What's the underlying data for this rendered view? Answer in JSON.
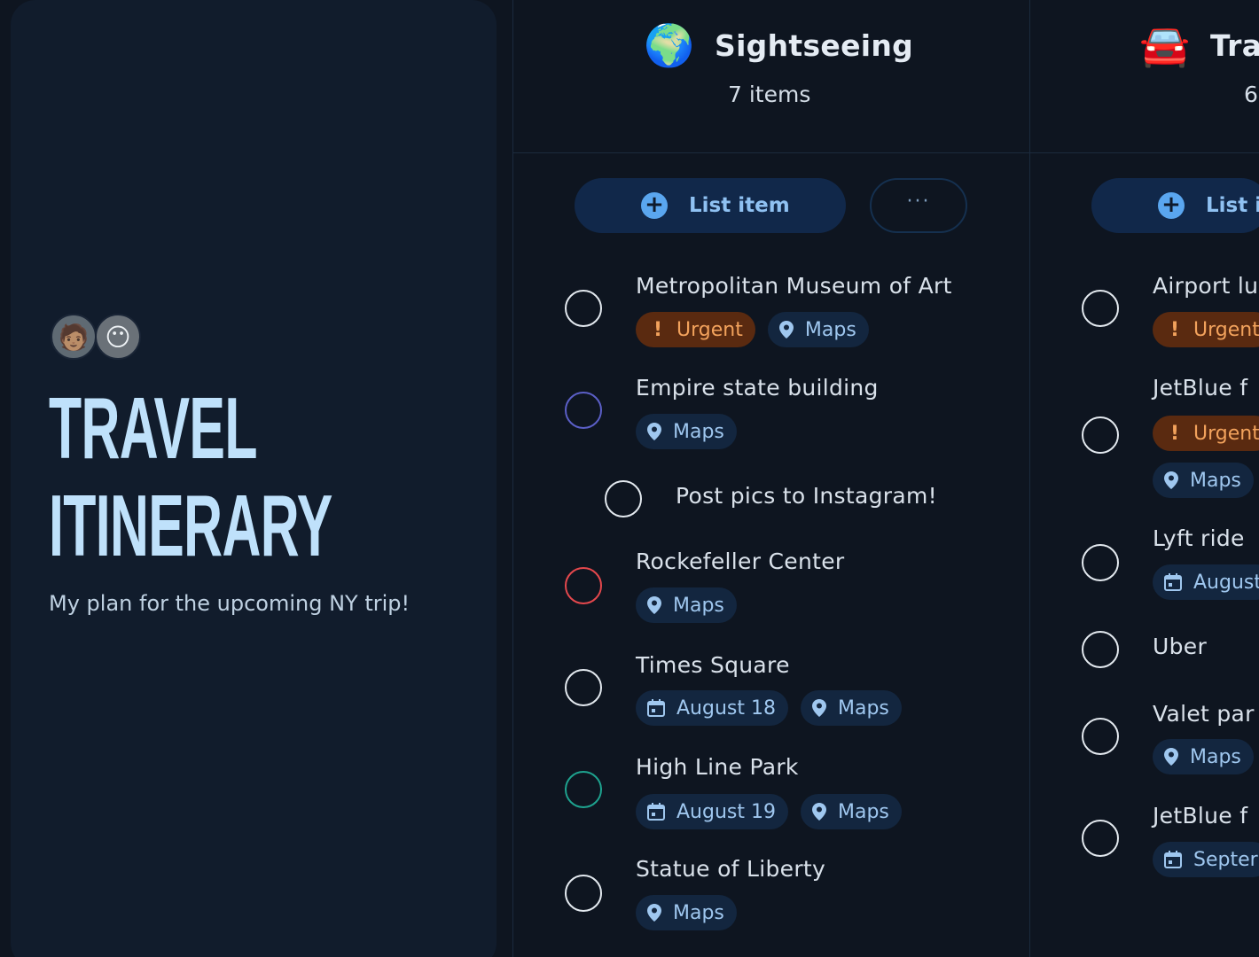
{
  "sidebar": {
    "avatars": [
      "🧑🏽",
      "😶"
    ],
    "title_line1": "TRAVEL",
    "title_line2": "ITINERARY",
    "description": "My plan for the upcoming NY trip!"
  },
  "columns": [
    {
      "emoji": "🌍",
      "name": "Sightseeing",
      "count": "7 items",
      "add_label": "List item",
      "more_label": "···",
      "items": [
        {
          "title": "Metropolitan Museum of Art",
          "check_color": "#e3e9ef",
          "tags": [
            {
              "type": "urgent",
              "label": "Urgent",
              "icon": "!"
            },
            {
              "type": "maps",
              "label": "Maps",
              "icon": "map-pin-icon"
            }
          ]
        },
        {
          "title": "Empire state building",
          "check_color": "#5b5fc7",
          "tags": [
            {
              "type": "maps",
              "label": "Maps",
              "icon": "map-pin-icon"
            }
          ]
        },
        {
          "title": "Post pics to Instagram!",
          "check_color": "#e3e9ef",
          "tags": []
        },
        {
          "title": "Rockefeller Center",
          "check_color": "#e5484d",
          "tags": [
            {
              "type": "maps",
              "label": "Maps",
              "icon": "map-pin-icon"
            }
          ]
        },
        {
          "title": "Times Square",
          "check_color": "#e3e9ef",
          "tags": [
            {
              "type": "date",
              "label": "August 18",
              "icon": "calendar-icon"
            },
            {
              "type": "maps",
              "label": "Maps",
              "icon": "map-pin-icon"
            }
          ]
        },
        {
          "title": "High Line Park",
          "check_color": "#1ea38f",
          "tags": [
            {
              "type": "date",
              "label": "August 19",
              "icon": "calendar-icon"
            },
            {
              "type": "maps",
              "label": "Maps",
              "icon": "map-pin-icon"
            }
          ]
        },
        {
          "title": "Statue of Liberty",
          "check_color": "#e3e9ef",
          "tags": [
            {
              "type": "maps",
              "label": "Maps",
              "icon": "map-pin-icon"
            }
          ]
        }
      ]
    },
    {
      "emoji": "🚘",
      "name": "Tra",
      "count": "6",
      "add_label": "List i",
      "items": [
        {
          "title": "Airport lu",
          "tags": [
            {
              "type": "urgent",
              "label": "Urgent",
              "icon": "!"
            }
          ]
        },
        {
          "title": "JetBlue f",
          "tags": [
            {
              "type": "urgent",
              "label": "Urgent",
              "icon": "!"
            },
            {
              "type": "maps",
              "label": "Maps",
              "icon": "map-pin-icon"
            }
          ]
        },
        {
          "title": "Lyft ride",
          "tags": [
            {
              "type": "date",
              "label": "August",
              "icon": "calendar-icon"
            }
          ]
        },
        {
          "title": "Uber",
          "tags": []
        },
        {
          "title": "Valet par",
          "tags": [
            {
              "type": "maps",
              "label": "Maps",
              "icon": "map-pin-icon"
            }
          ]
        },
        {
          "title": "JetBlue f",
          "tags": [
            {
              "type": "date",
              "label": "Septer",
              "icon": "calendar-icon"
            }
          ]
        }
      ]
    }
  ]
}
